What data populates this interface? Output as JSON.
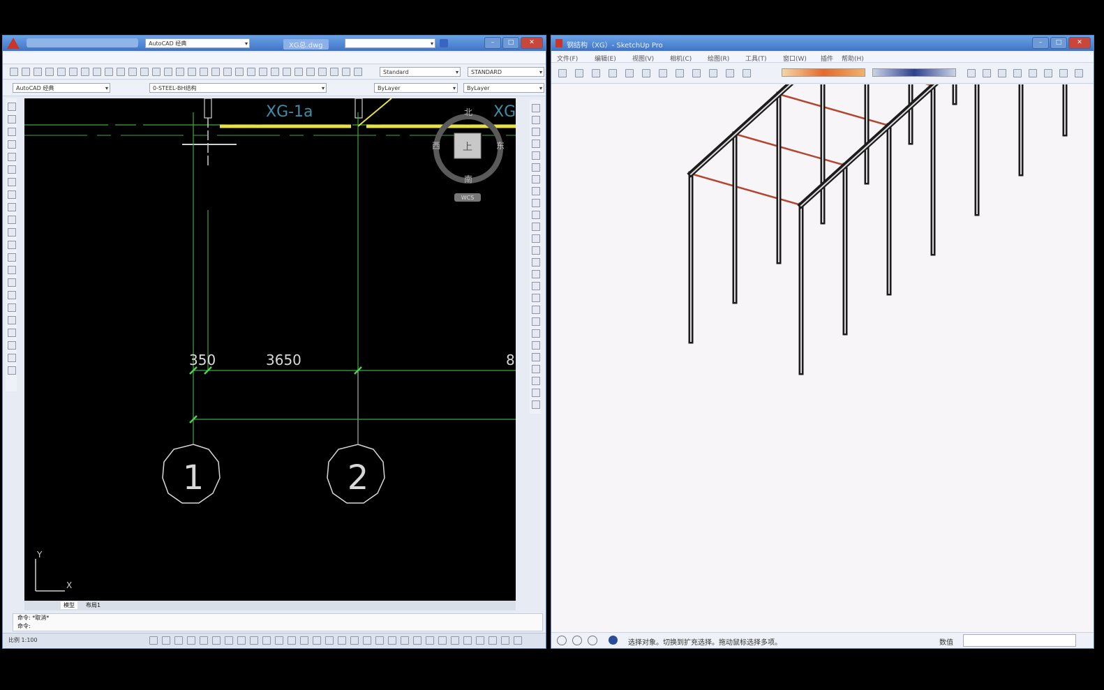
{
  "autocad": {
    "title": "XG总.dwg",
    "workspace": "AutoCAD 经典",
    "workspace2": "AutoCAD 经典",
    "text_style": "Standard",
    "dim_style": "STANDARD",
    "layer": "0-STEEL-BH结构",
    "color": "ByLayer",
    "linetype": "ByLayer",
    "drawing": {
      "label_top": "XG-1a",
      "label_top_right": "XG",
      "dim1": "350",
      "dim2": "3650",
      "dim3": "8",
      "axis1": "1",
      "axis2": "2"
    },
    "viewcube": {
      "north": "北",
      "south": "南",
      "east": "东",
      "west": "西",
      "face": "上",
      "wcs": "WCS"
    },
    "ucs": {
      "y": "Y",
      "x": "X"
    },
    "tabs": [
      "模型",
      "布局1"
    ],
    "command_line1": "命令: *取消*",
    "command_line2": "命令:",
    "status_scale": "比例 1:100"
  },
  "sketchup": {
    "title": "钢结构（XG）- SketchUp Pro",
    "menus": [
      "文件(F)",
      "编辑(E)",
      "视图(V)",
      "相机(C)",
      "绘图(R)",
      "工具(T)",
      "窗口(W)",
      "插件",
      "帮助(H)"
    ],
    "status_text": "选择对象。切换到扩充选择。拖动鼠标选择多项。",
    "measure_label": "数值",
    "measure_value": ""
  },
  "colors": {
    "cad_bg": "#000000",
    "cad_green": "#3fa83f",
    "cad_yellow": "#e8e04a",
    "cad_text": "#d8d8d8",
    "steel_frame": "#1c1c1c",
    "steel_brace": "#b4452f",
    "su_bg": "#f7f5f7"
  }
}
